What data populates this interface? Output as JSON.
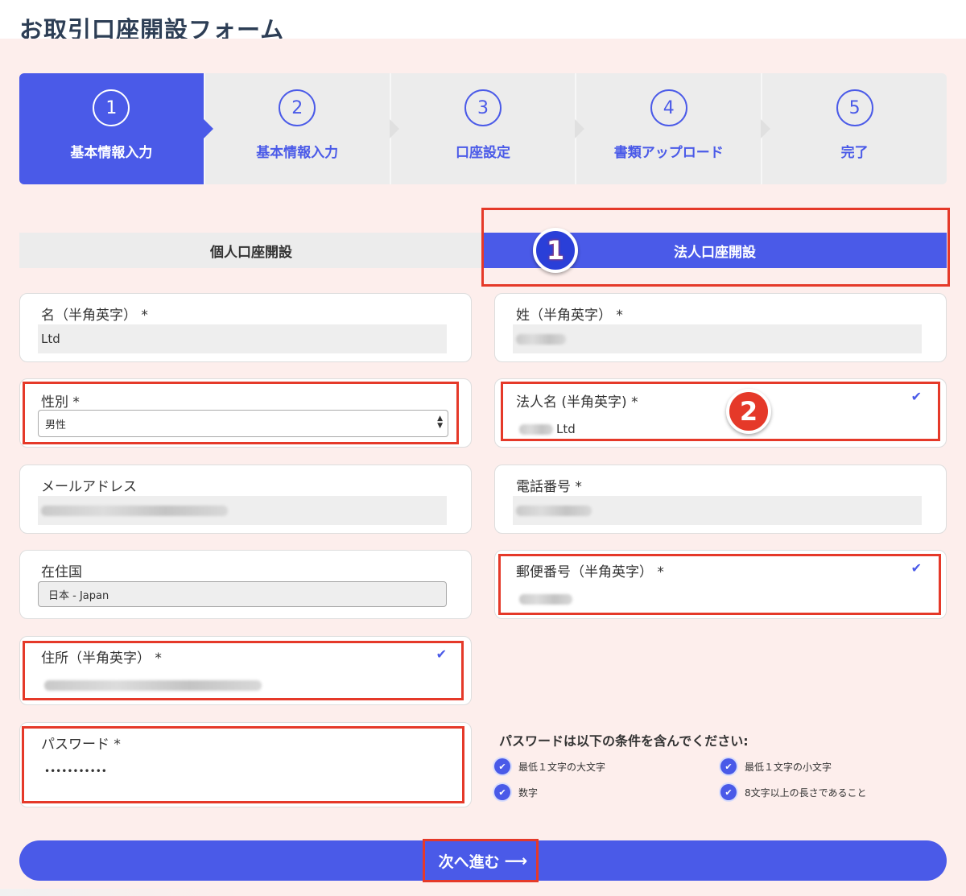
{
  "page": {
    "title": "お取引口座開設フォーム"
  },
  "steps": [
    {
      "num": "1",
      "label": "基本情報入力"
    },
    {
      "num": "2",
      "label": "基本情報入力"
    },
    {
      "num": "3",
      "label": "口座設定"
    },
    {
      "num": "4",
      "label": "書類アップロード"
    },
    {
      "num": "5",
      "label": "完了"
    }
  ],
  "tabs": {
    "personal": "個人口座開設",
    "corporate": "法人口座開設"
  },
  "annotations": {
    "badge1": "1",
    "badge2": "2"
  },
  "form": {
    "first_name": {
      "label": "名（半角英字） *",
      "value": "Ltd"
    },
    "last_name": {
      "label": "姓（半角英字） *"
    },
    "gender": {
      "label": "性別 *",
      "value": "男性"
    },
    "company_name": {
      "label": "法人名 (半角英字) *",
      "value_suffix": "Ltd"
    },
    "email": {
      "label": "メールアドレス"
    },
    "phone": {
      "label": "電話番号 *"
    },
    "country": {
      "label": "在住国",
      "value": "日本 - Japan"
    },
    "postal_code": {
      "label": "郵便番号（半角英字） *"
    },
    "address": {
      "label": "住所（半角英字） *"
    },
    "password": {
      "label": "パスワード *",
      "value": "•••••••••••"
    }
  },
  "password_conditions": {
    "title": "パスワードは以下の条件を含んでください:",
    "items": [
      "最低１文字の大文字",
      "最低１文字の小文字",
      "数字",
      "8文字以上の長さであること"
    ]
  },
  "next_button": {
    "label": "次へ進む",
    "arrow": "⟶"
  },
  "colors": {
    "accent": "#4a5ae8",
    "annotation": "#e53929",
    "panel_bg": "#fdeeec"
  }
}
